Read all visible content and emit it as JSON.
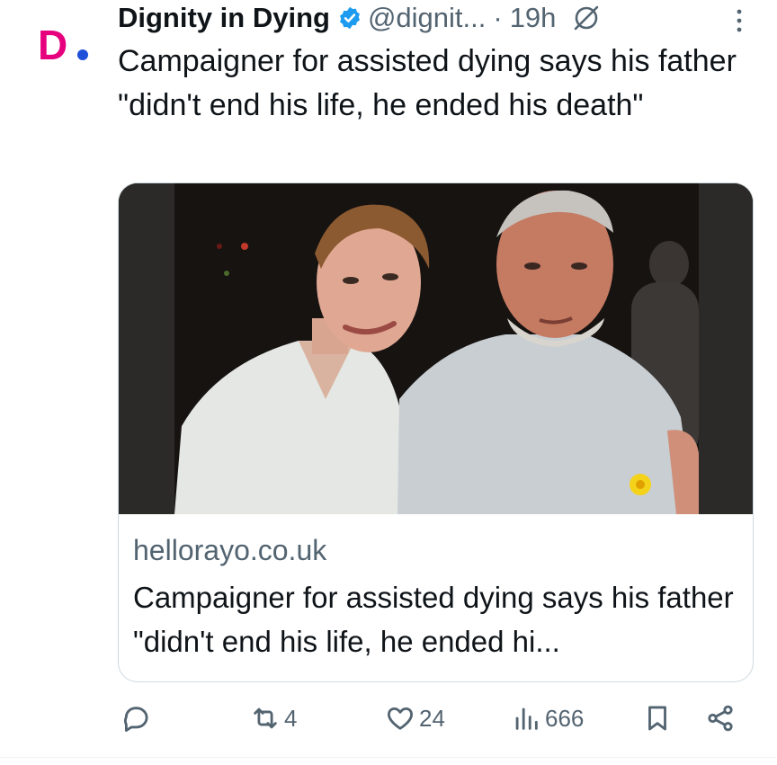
{
  "tweet": {
    "author_name": "Dignity in Dying",
    "handle": "@dignit...",
    "separator": "·",
    "time": "19h",
    "text": "Campaigner for assisted dying says his father \"didn't end his life, he ended his death\""
  },
  "avatar": {
    "letter": "D"
  },
  "card": {
    "domain": "hellorayo.co.uk",
    "title": "Campaigner for assisted dying says his father \"didn't end his life, he ended hi..."
  },
  "actions": {
    "replies": "",
    "reposts": "4",
    "likes": "24",
    "views": "666"
  },
  "colors": {
    "brand_pink": "#e6007e",
    "brand_blue": "#1d4fd8",
    "verified": "#1d9bf0",
    "muted": "#536471"
  },
  "icons": [
    "verified-badge-icon",
    "grok-icon",
    "more-icon",
    "reply-icon",
    "repost-icon",
    "like-icon",
    "views-icon",
    "bookmark-icon",
    "share-icon"
  ]
}
